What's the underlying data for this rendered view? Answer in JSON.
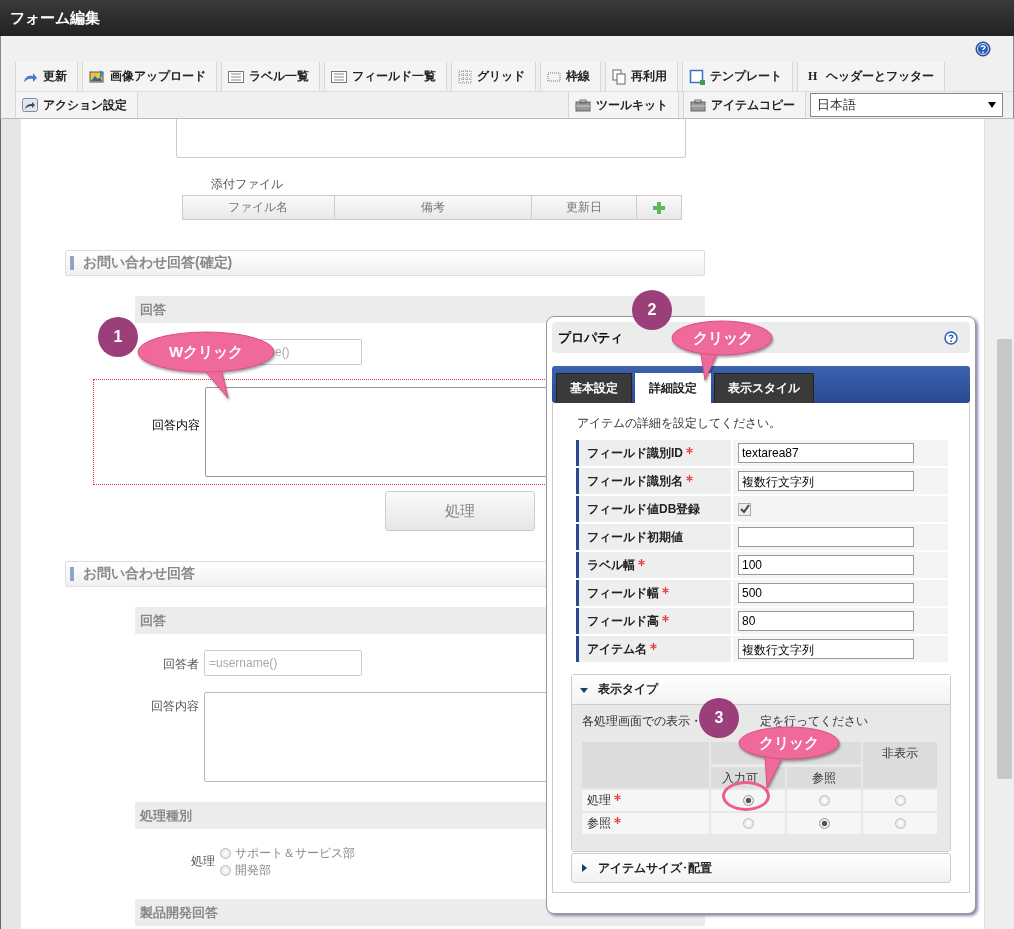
{
  "window": {
    "title": "フォーム編集"
  },
  "toolbar": {
    "row1": [
      {
        "label": "更新",
        "kind": "refresh"
      },
      {
        "label": "画像アップロード",
        "kind": "image-upload"
      },
      {
        "label": "ラベル一覧",
        "kind": "list"
      },
      {
        "label": "フィールド一覧",
        "kind": "list"
      },
      {
        "label": "グリッド",
        "kind": "grid"
      },
      {
        "label": "枠線",
        "kind": "border"
      },
      {
        "label": "再利用",
        "kind": "copy"
      },
      {
        "label": "テンプレート",
        "kind": "template"
      },
      {
        "label": "ヘッダーとフッター",
        "kind": "glyph",
        "glyph": "H"
      }
    ],
    "row2_left": [
      {
        "label": "アクション設定",
        "kind": "share"
      }
    ],
    "row2_right": [
      {
        "label": "ツールキット",
        "kind": "toolbox"
      },
      {
        "label": "アイテムコピー",
        "kind": "toolbox"
      }
    ],
    "language": "日本語"
  },
  "form": {
    "attachments": {
      "label": "添付ファイル",
      "columns": [
        "ファイル名",
        "備考",
        "更新日"
      ]
    },
    "sections": [
      {
        "title": "お問い合わせ回答(確定)",
        "groups": [
          {
            "title": "回答",
            "fields": [
              {
                "kind": "text",
                "placeholder": "e()",
                "selected": false
              },
              {
                "kind": "textarea",
                "label": "回答内容",
                "selected": true
              }
            ]
          }
        ],
        "buttons": [
          {
            "label": "処理"
          }
        ]
      },
      {
        "title": "お問い合わせ回答",
        "groups": [
          {
            "title": "回答",
            "fields": [
              {
                "kind": "text",
                "label": "回答者",
                "placeholder": "=username()",
                "selected": false
              },
              {
                "kind": "textarea",
                "label": "回答内容",
                "selected": false
              }
            ]
          },
          {
            "title": "処理種別",
            "fields": [
              {
                "kind": "radio",
                "label": "処理",
                "selected": false,
                "options": [
                  {
                    "label": "サポート＆サービス部",
                    "selected": false
                  },
                  {
                    "label": "開発部",
                    "selected": false
                  }
                ]
              }
            ]
          },
          {
            "title": "製品開発回答"
          }
        ]
      }
    ]
  },
  "properties_dialog": {
    "title": "プロパティ",
    "tabs": [
      {
        "label": "基本設定",
        "selected": false
      },
      {
        "label": "詳細設定",
        "selected": true
      },
      {
        "label": "表示スタイル",
        "selected": false
      }
    ],
    "description": "アイテムの詳細を設定してください。",
    "rows": [
      {
        "label": "フィールド識別ID",
        "required": true,
        "kind": "text",
        "value": "textarea87"
      },
      {
        "label": "フィールド識別名",
        "required": true,
        "kind": "text",
        "value": "複数行文字列"
      },
      {
        "label": "フィールド値DB登録",
        "required": false,
        "kind": "checkbox",
        "checked": true
      },
      {
        "label": "フィールド初期値",
        "required": false,
        "kind": "text"
      },
      {
        "label": "ラベル幅",
        "required": true,
        "kind": "text",
        "value": "100"
      },
      {
        "label": "フィールド幅",
        "required": true,
        "kind": "text",
        "value": "500"
      },
      {
        "label": "フィールド高",
        "required": true,
        "kind": "text",
        "value": "80"
      },
      {
        "label": "アイテム名",
        "required": true,
        "kind": "text",
        "value": "複数行文字列"
      }
    ],
    "display_type": {
      "title": "表示タイプ",
      "expanded": true,
      "note_parts": [
        "各処理画面での表示・",
        "定を行ってください"
      ],
      "columns": [
        "入力可",
        "参照",
        "非表示"
      ],
      "rows": [
        {
          "label": "処理",
          "required": true,
          "options": [
            {
              "selected": true
            },
            {
              "selected": false
            },
            {
              "selected": false
            }
          ]
        },
        {
          "label": "参照",
          "required": true,
          "options": [
            {
              "selected": false
            },
            {
              "selected": true
            },
            {
              "selected": false
            }
          ]
        }
      ]
    },
    "size_section": {
      "title": "アイテムサイズ･配置",
      "expanded": false
    }
  },
  "callouts": [
    {
      "number": "1",
      "label": "Wクリック",
      "highlight": false
    },
    {
      "number": "2",
      "label": "クリック",
      "highlight": false
    },
    {
      "number": "3",
      "label": "クリック",
      "highlight": true
    }
  ]
}
